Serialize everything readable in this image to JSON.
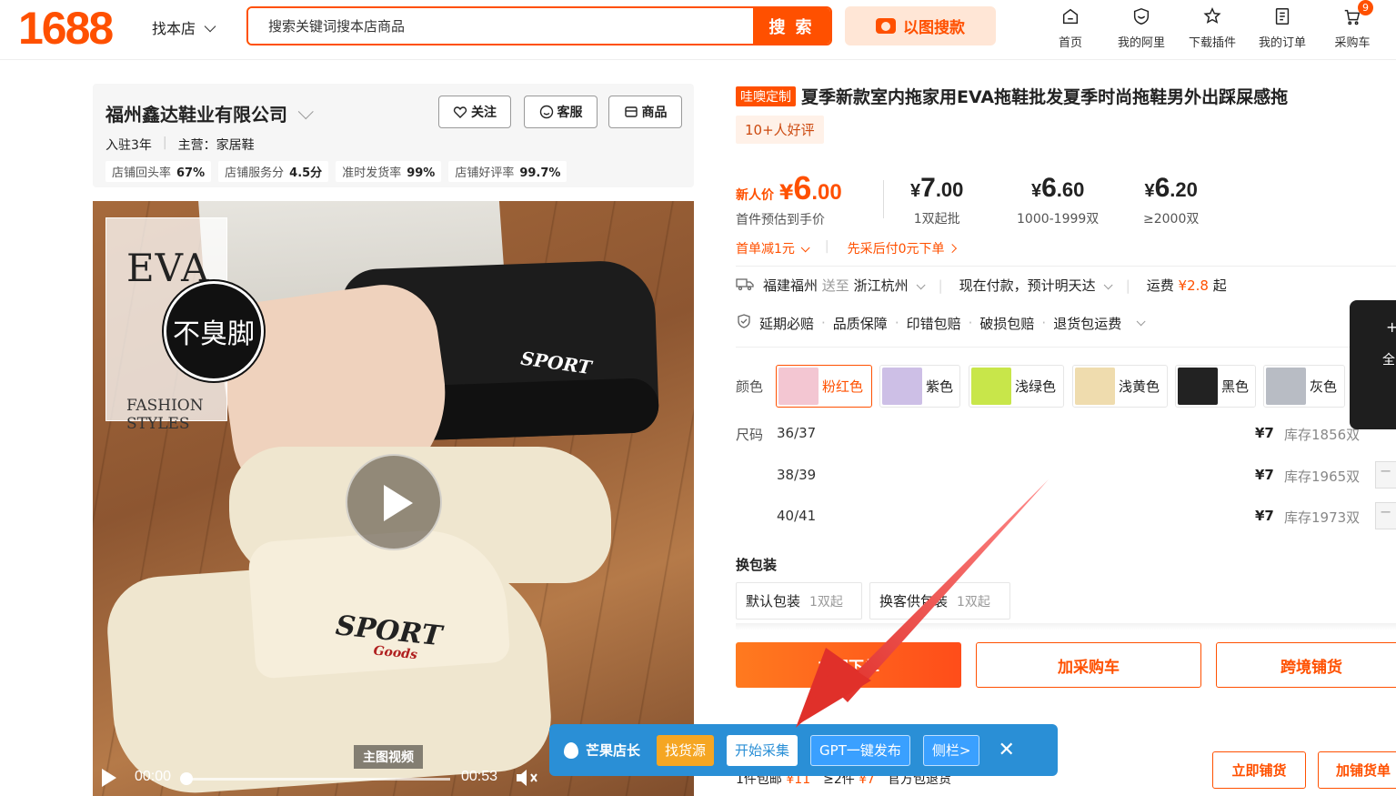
{
  "header": {
    "logo": "1688",
    "store_switch": "找本店",
    "search": {
      "placeholder": "搜索关键词搜本店商品",
      "button": "搜 索"
    },
    "image_search": "以图搜款",
    "nav": [
      {
        "label": "首页",
        "icon": "home-icon"
      },
      {
        "label": "我的阿里",
        "icon": "user-shield-icon"
      },
      {
        "label": "下载插件",
        "icon": "puzzle-icon"
      },
      {
        "label": "我的订单",
        "icon": "order-icon"
      },
      {
        "label": "采购车",
        "icon": "cart-icon",
        "badge": "9"
      }
    ]
  },
  "store": {
    "name": "福州鑫达鞋业有限公司",
    "years": "入驻3年",
    "main_business": "主营：家居鞋",
    "stats": [
      {
        "label": "店铺回头率",
        "value": "67%"
      },
      {
        "label": "店铺服务分",
        "value": "4.5分"
      },
      {
        "label": "准时发货率",
        "value": "99%"
      },
      {
        "label": "店铺好评率",
        "value": "99.7%"
      }
    ],
    "buttons": {
      "follow": "关注",
      "service": "客服",
      "products": "商品"
    }
  },
  "media": {
    "eva": "EVA",
    "badge": "不臭脚",
    "sub1": "FASHION",
    "sub2": "STYLES",
    "sport1": "SPORT",
    "sport2": "SPORT",
    "sport2_sub": "Goods",
    "video_tag": "主图视频",
    "time_current": "00:00",
    "time_total": "00:53"
  },
  "product": {
    "custom_tag": "哇噢定制",
    "title": "夏季新款室内拖家用EVA拖鞋批发夏季时尚拖鞋男外出踩屎感拖",
    "review_badge": "10+人好评",
    "price_new": {
      "label": "新人价",
      "yen": "¥",
      "int": "6",
      "dec": ".00",
      "sub": "首件预估到手价"
    },
    "tiers": [
      {
        "yen": "¥",
        "int": "7",
        "dec": ".00",
        "qty": "1双起批"
      },
      {
        "yen": "¥",
        "int": "6",
        "dec": ".60",
        "qty": "1000-1999双"
      },
      {
        "yen": "¥",
        "int": "6",
        "dec": ".20",
        "qty": "≥2000双"
      }
    ],
    "promo_first": "首单减1元",
    "promo_paylater": "先采后付0元下单",
    "shipping": {
      "from": "福建福州",
      "to_word": "送至",
      "to": "浙江杭州",
      "pay": "现在付款，预计明天达",
      "fee_label": "运费",
      "fee": "¥2.8",
      "fee_suffix": "起"
    },
    "guarantees": [
      "延期必赔",
      "品质保障",
      "印错包赔",
      "破损包赔",
      "退货包运费"
    ],
    "color_label": "颜色",
    "colors": [
      {
        "name": "粉红色",
        "swatch": "#f3c6d2",
        "selected": true
      },
      {
        "name": "紫色",
        "swatch": "#cdbfe6"
      },
      {
        "name": "浅绿色",
        "swatch": "#c8e64a"
      },
      {
        "name": "浅黄色",
        "swatch": "#efdcae"
      },
      {
        "name": "黑色",
        "swatch": "#222222"
      },
      {
        "name": "灰色",
        "swatch": "#b8bcc4"
      }
    ],
    "size_label": "尺码",
    "sizes": [
      {
        "size": "36/37",
        "price": "¥7",
        "stock": "库存1856双"
      },
      {
        "size": "38/39",
        "price": "¥7",
        "stock": "库存1965双"
      },
      {
        "size": "40/41",
        "price": "¥7",
        "stock": "库存1973双"
      }
    ],
    "pack_title": "换包装",
    "packs": [
      {
        "name": "默认包装",
        "min": "1双起"
      },
      {
        "name": "换客供包装",
        "min": "1双起"
      }
    ],
    "actions": {
      "buy": "立即下单",
      "add_cart": "加采购车",
      "cross": "跨境铺货"
    },
    "footer": {
      "ship1": "1件包邮",
      "ship1_price": "¥11",
      "ship2": "≥2件",
      "ship2_price": "¥7",
      "return": "官方包退货",
      "btn_dist": "立即铺货",
      "btn_add_dist": "加铺货单"
    }
  },
  "side_panel": {
    "plus": "+",
    "label": "全"
  },
  "extension": {
    "name": "芒果店长",
    "buttons": [
      "找货源",
      "开始采集",
      "GPT一键发布",
      "侧栏>"
    ],
    "close": "✕"
  },
  "colors": {
    "brand": "#ff5000",
    "ext_blue": "#2a8fd6"
  }
}
